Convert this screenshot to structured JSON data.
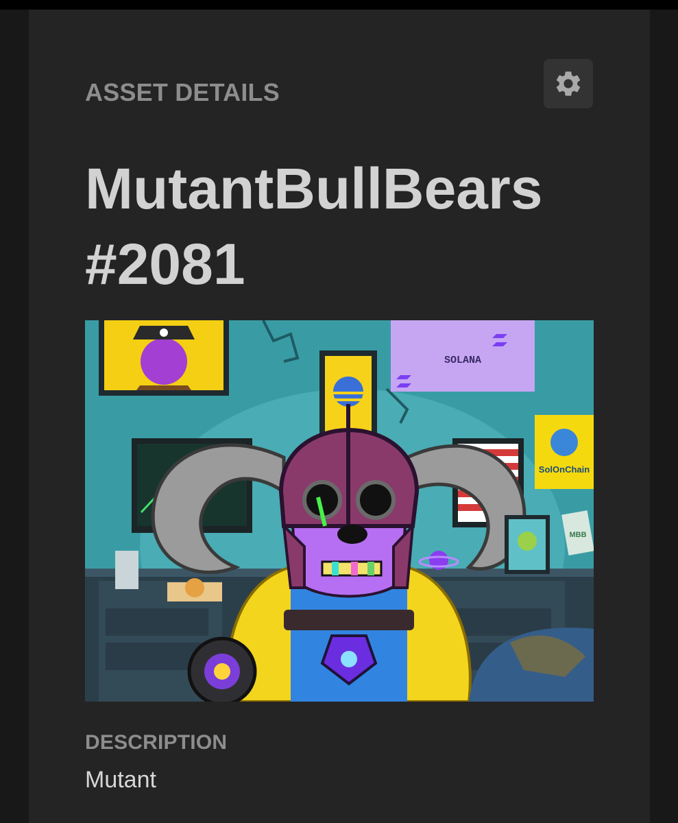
{
  "section_label": "ASSET DETAILS",
  "settings": {
    "icon": "gear-icon"
  },
  "asset": {
    "title": "MutantBullBears #2081",
    "image": {
      "poster_text": "SOLANA",
      "sign_text": "SolOnChain",
      "note_text": "MBB"
    }
  },
  "description": {
    "label": "DESCRIPTION",
    "value": "Mutant"
  },
  "colors": {
    "background": "#242424",
    "label": "#8d8d8d",
    "title": "#d2d2d2",
    "button": "#333333",
    "icon": "#a9a9a9"
  }
}
